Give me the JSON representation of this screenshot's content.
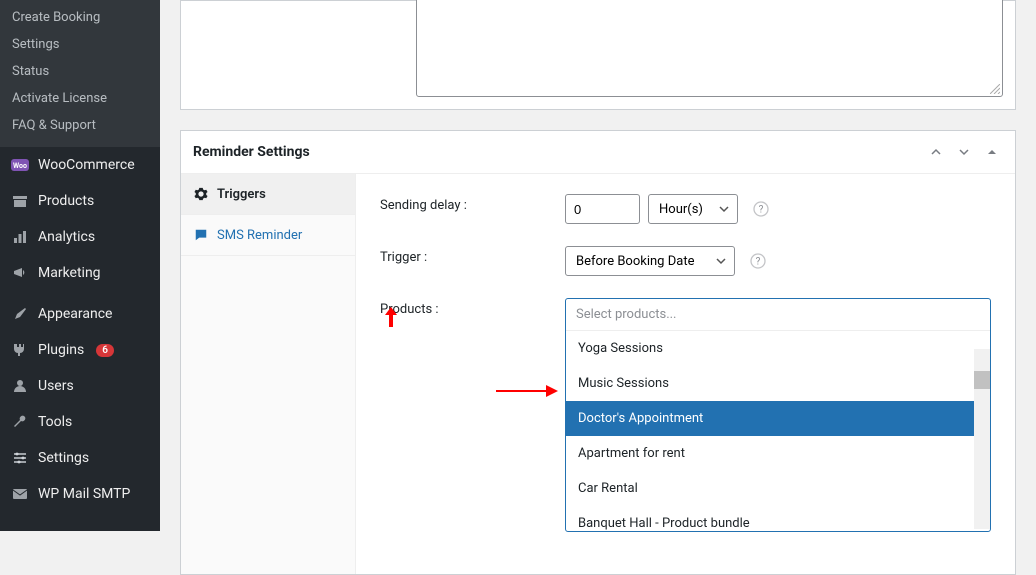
{
  "sidebar": {
    "submenu": [
      {
        "label": "Create Booking"
      },
      {
        "label": "Settings"
      },
      {
        "label": "Status"
      },
      {
        "label": "Activate License"
      },
      {
        "label": "FAQ & Support"
      }
    ],
    "items": [
      {
        "label": "WooCommerce"
      },
      {
        "label": "Products"
      },
      {
        "label": "Analytics"
      },
      {
        "label": "Marketing"
      },
      {
        "label": "Appearance"
      },
      {
        "label": "Plugins",
        "badge": "6"
      },
      {
        "label": "Users"
      },
      {
        "label": "Tools"
      },
      {
        "label": "Settings"
      },
      {
        "label": "WP Mail SMTP"
      }
    ]
  },
  "panel": {
    "title": "Reminder Settings",
    "tabs": {
      "triggers": "Triggers",
      "sms": "SMS Reminder"
    },
    "form": {
      "sending_delay_label": "Sending delay :",
      "sending_delay_value": "0",
      "unit_value": "Hour(s)",
      "trigger_label": "Trigger :",
      "trigger_value": "Before Booking Date",
      "products_label": "Products :",
      "products_placeholder": "Select products...",
      "product_options": [
        "Yoga Sessions",
        "Music Sessions",
        "Doctor's Appointment",
        "Apartment for rent",
        "Car Rental",
        "Banquet Hall - Product bundle"
      ]
    }
  }
}
